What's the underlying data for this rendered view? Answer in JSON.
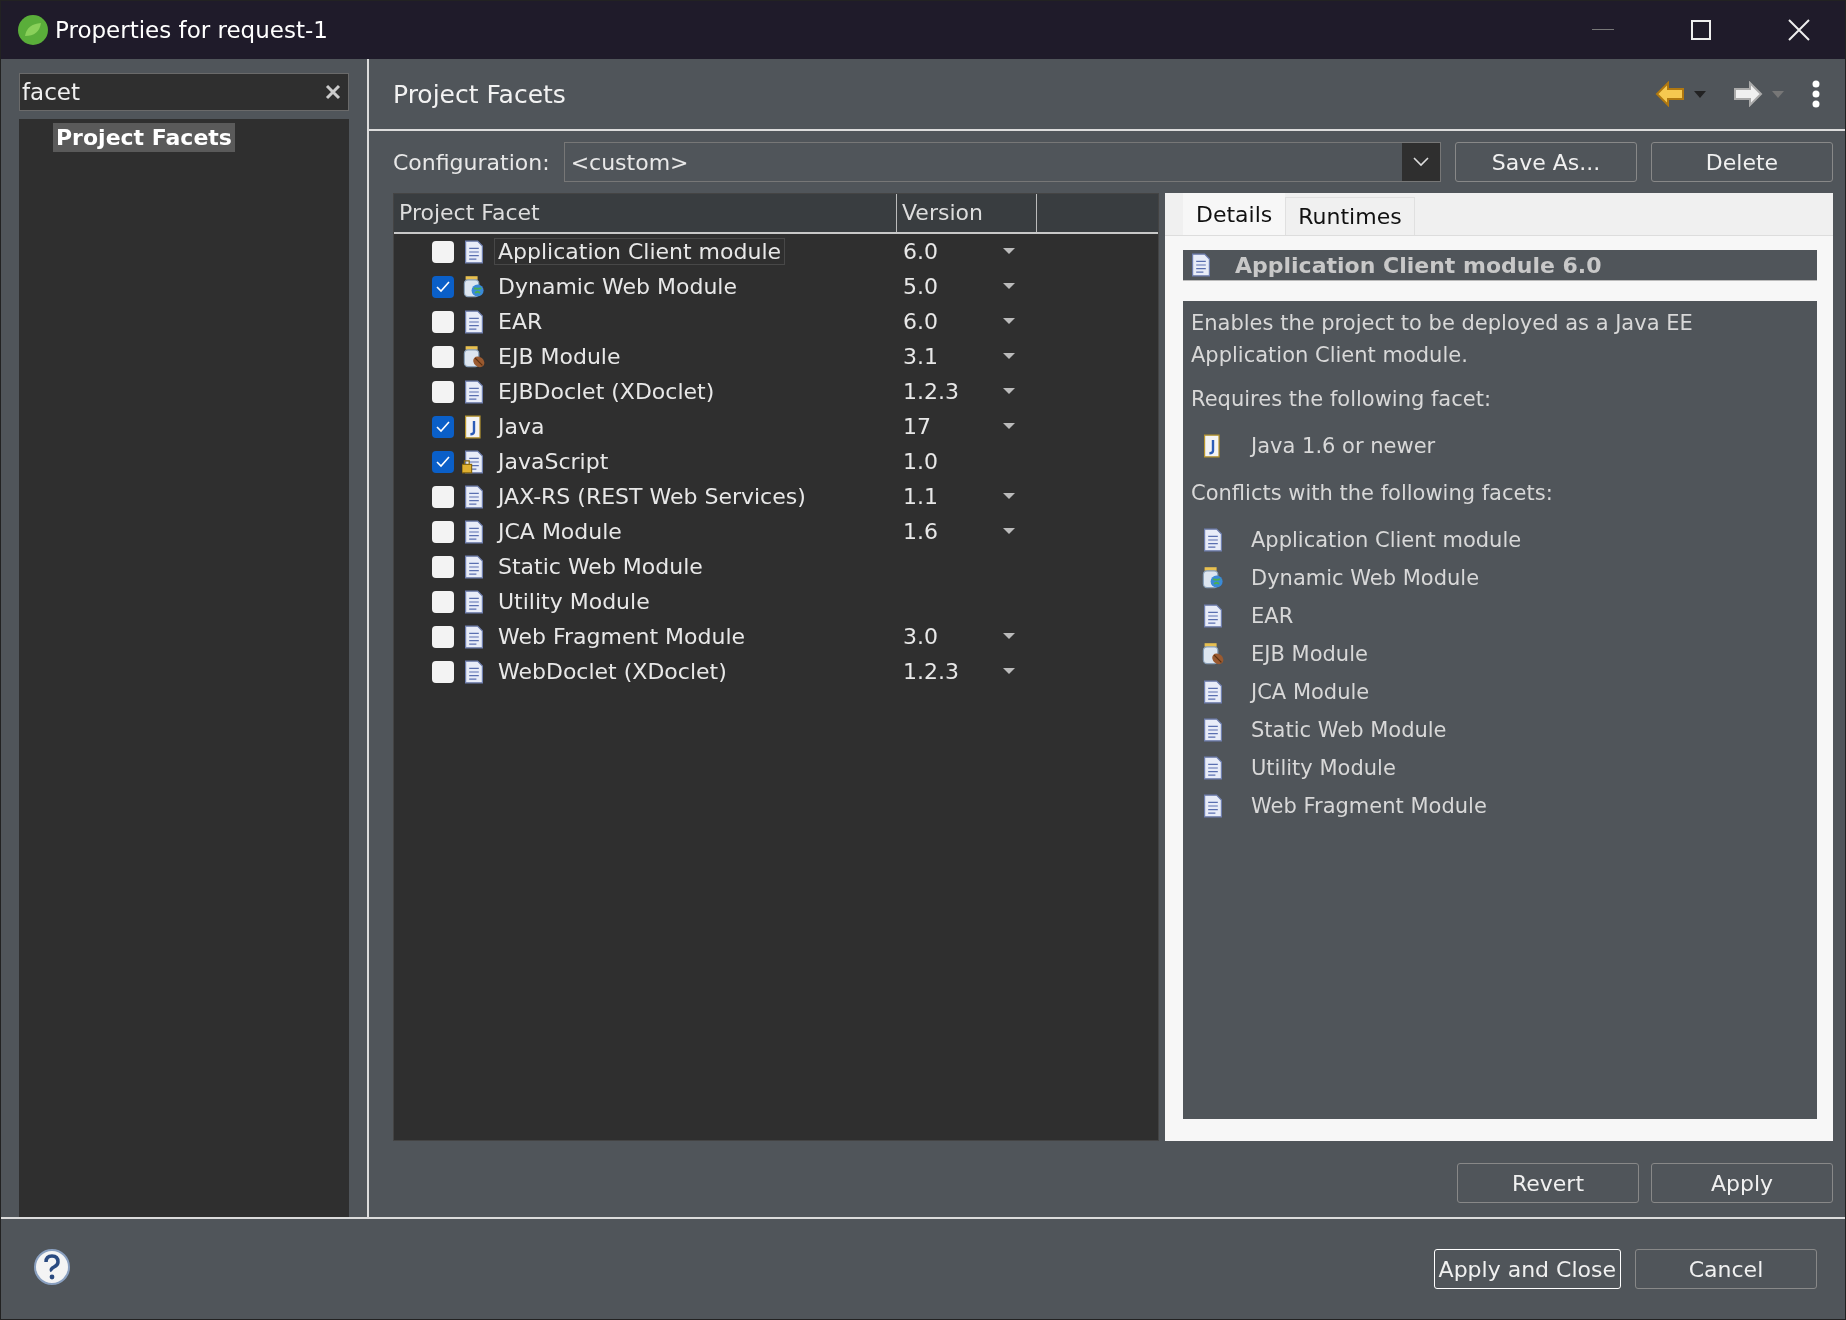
{
  "window": {
    "title": "Properties for request-1"
  },
  "filter": {
    "value": "facet"
  },
  "nav_tree": [
    {
      "label": "Project Facets",
      "selected": true
    }
  ],
  "page": {
    "title": "Project Facets"
  },
  "configuration": {
    "label": "Configuration:",
    "value": "<custom>",
    "buttons": [
      "Save As...",
      "Delete"
    ]
  },
  "table": {
    "columns": [
      "Project Facet",
      "Version"
    ],
    "rows": [
      {
        "name": "Application Client module",
        "version": "6.0",
        "checked": false,
        "selected": true,
        "kind": "doc",
        "dropdown": true
      },
      {
        "name": "Dynamic Web Module",
        "version": "5.0",
        "checked": true,
        "selected": false,
        "kind": "web",
        "dropdown": true
      },
      {
        "name": "EAR",
        "version": "6.0",
        "checked": false,
        "selected": false,
        "kind": "doc",
        "dropdown": true
      },
      {
        "name": "EJB Module",
        "version": "3.1",
        "checked": false,
        "selected": false,
        "kind": "ejb",
        "dropdown": true
      },
      {
        "name": "EJBDoclet (XDoclet)",
        "version": "1.2.3",
        "checked": false,
        "selected": false,
        "kind": "doc",
        "dropdown": true
      },
      {
        "name": "Java",
        "version": "17",
        "checked": true,
        "selected": false,
        "kind": "java",
        "dropdown": true
      },
      {
        "name": "JavaScript",
        "version": "1.0",
        "checked": true,
        "selected": false,
        "kind": "locked",
        "dropdown": false
      },
      {
        "name": "JAX-RS (REST Web Services)",
        "version": "1.1",
        "checked": false,
        "selected": false,
        "kind": "doc",
        "dropdown": true
      },
      {
        "name": "JCA Module",
        "version": "1.6",
        "checked": false,
        "selected": false,
        "kind": "doc",
        "dropdown": true
      },
      {
        "name": "Static Web Module",
        "checked": false,
        "selected": false,
        "kind": "doc",
        "dropdown": false
      },
      {
        "name": "Utility Module",
        "checked": false,
        "selected": false,
        "kind": "doc",
        "dropdown": false
      },
      {
        "name": "Web Fragment Module",
        "version": "3.0",
        "checked": false,
        "selected": false,
        "kind": "doc",
        "dropdown": true
      },
      {
        "name": "WebDoclet (XDoclet)",
        "version": "1.2.3",
        "checked": false,
        "selected": false,
        "kind": "doc",
        "dropdown": true
      }
    ]
  },
  "details": {
    "tabs": [
      {
        "label": "Details",
        "selected": true
      },
      {
        "label": "Runtimes",
        "selected": false
      }
    ],
    "heading": "Application Client module 6.0",
    "description": "Enables the project to be deployed as a Java EE Application Client module.",
    "requires_label": "Requires the following facet:",
    "requires": [
      {
        "name": "Java 1.6 or newer",
        "kind": "java"
      }
    ],
    "conflicts_label": "Conflicts with the following facets:",
    "conflicts": [
      {
        "name": "Application Client module",
        "kind": "doc"
      },
      {
        "name": "Dynamic Web Module",
        "kind": "web"
      },
      {
        "name": "EAR",
        "kind": "doc"
      },
      {
        "name": "EJB Module",
        "kind": "ejb"
      },
      {
        "name": "JCA Module",
        "kind": "doc"
      },
      {
        "name": "Static Web Module",
        "kind": "doc"
      },
      {
        "name": "Utility Module",
        "kind": "doc"
      },
      {
        "name": "Web Fragment Module",
        "kind": "doc"
      }
    ]
  },
  "page_buttons": [
    "Revert",
    "Apply"
  ],
  "dialog_buttons": [
    {
      "label": "Apply and Close",
      "default": true
    },
    {
      "label": "Cancel",
      "default": false
    }
  ]
}
